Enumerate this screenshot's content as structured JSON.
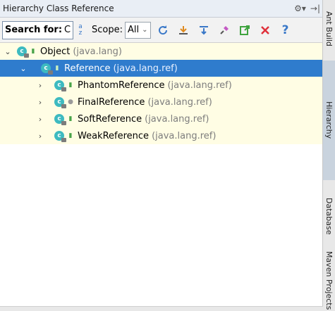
{
  "window": {
    "title": "Hierarchy Class Reference"
  },
  "toolbar": {
    "search_label": "Search for:",
    "search_value": "C",
    "scope_label": "Scope:",
    "scope_value": "All",
    "buttons": [
      "refresh-icon",
      "autoscroll-from-source-icon",
      "expand-all-icon",
      "pin-icon",
      "export-icon",
      "close-icon",
      "help-icon"
    ]
  },
  "tree": {
    "rows": [
      {
        "name": "Object",
        "pkg": "(java.lang)",
        "expanded": true,
        "level": 0,
        "selected": false
      },
      {
        "name": "Reference",
        "pkg": "(java.lang.ref)",
        "expanded": true,
        "level": 1,
        "selected": true
      },
      {
        "name": "PhantomReference",
        "pkg": "(java.lang.ref)",
        "expanded": false,
        "level": 2,
        "selected": false
      },
      {
        "name": "FinalReference",
        "pkg": "(java.lang.ref)",
        "expanded": false,
        "level": 2,
        "selected": false
      },
      {
        "name": "SoftReference",
        "pkg": "(java.lang.ref)",
        "expanded": false,
        "level": 2,
        "selected": false
      },
      {
        "name": "WeakReference",
        "pkg": "(java.lang.ref)",
        "expanded": false,
        "level": 2,
        "selected": false
      }
    ]
  },
  "sidebar": {
    "tabs": [
      "Ant Build",
      "Hierarchy",
      "Database",
      "Maven Projects"
    ]
  },
  "colors": {
    "selection": "#2f7ccd",
    "row_bg": "#fffde4",
    "class_icon": "#3dbac0"
  }
}
